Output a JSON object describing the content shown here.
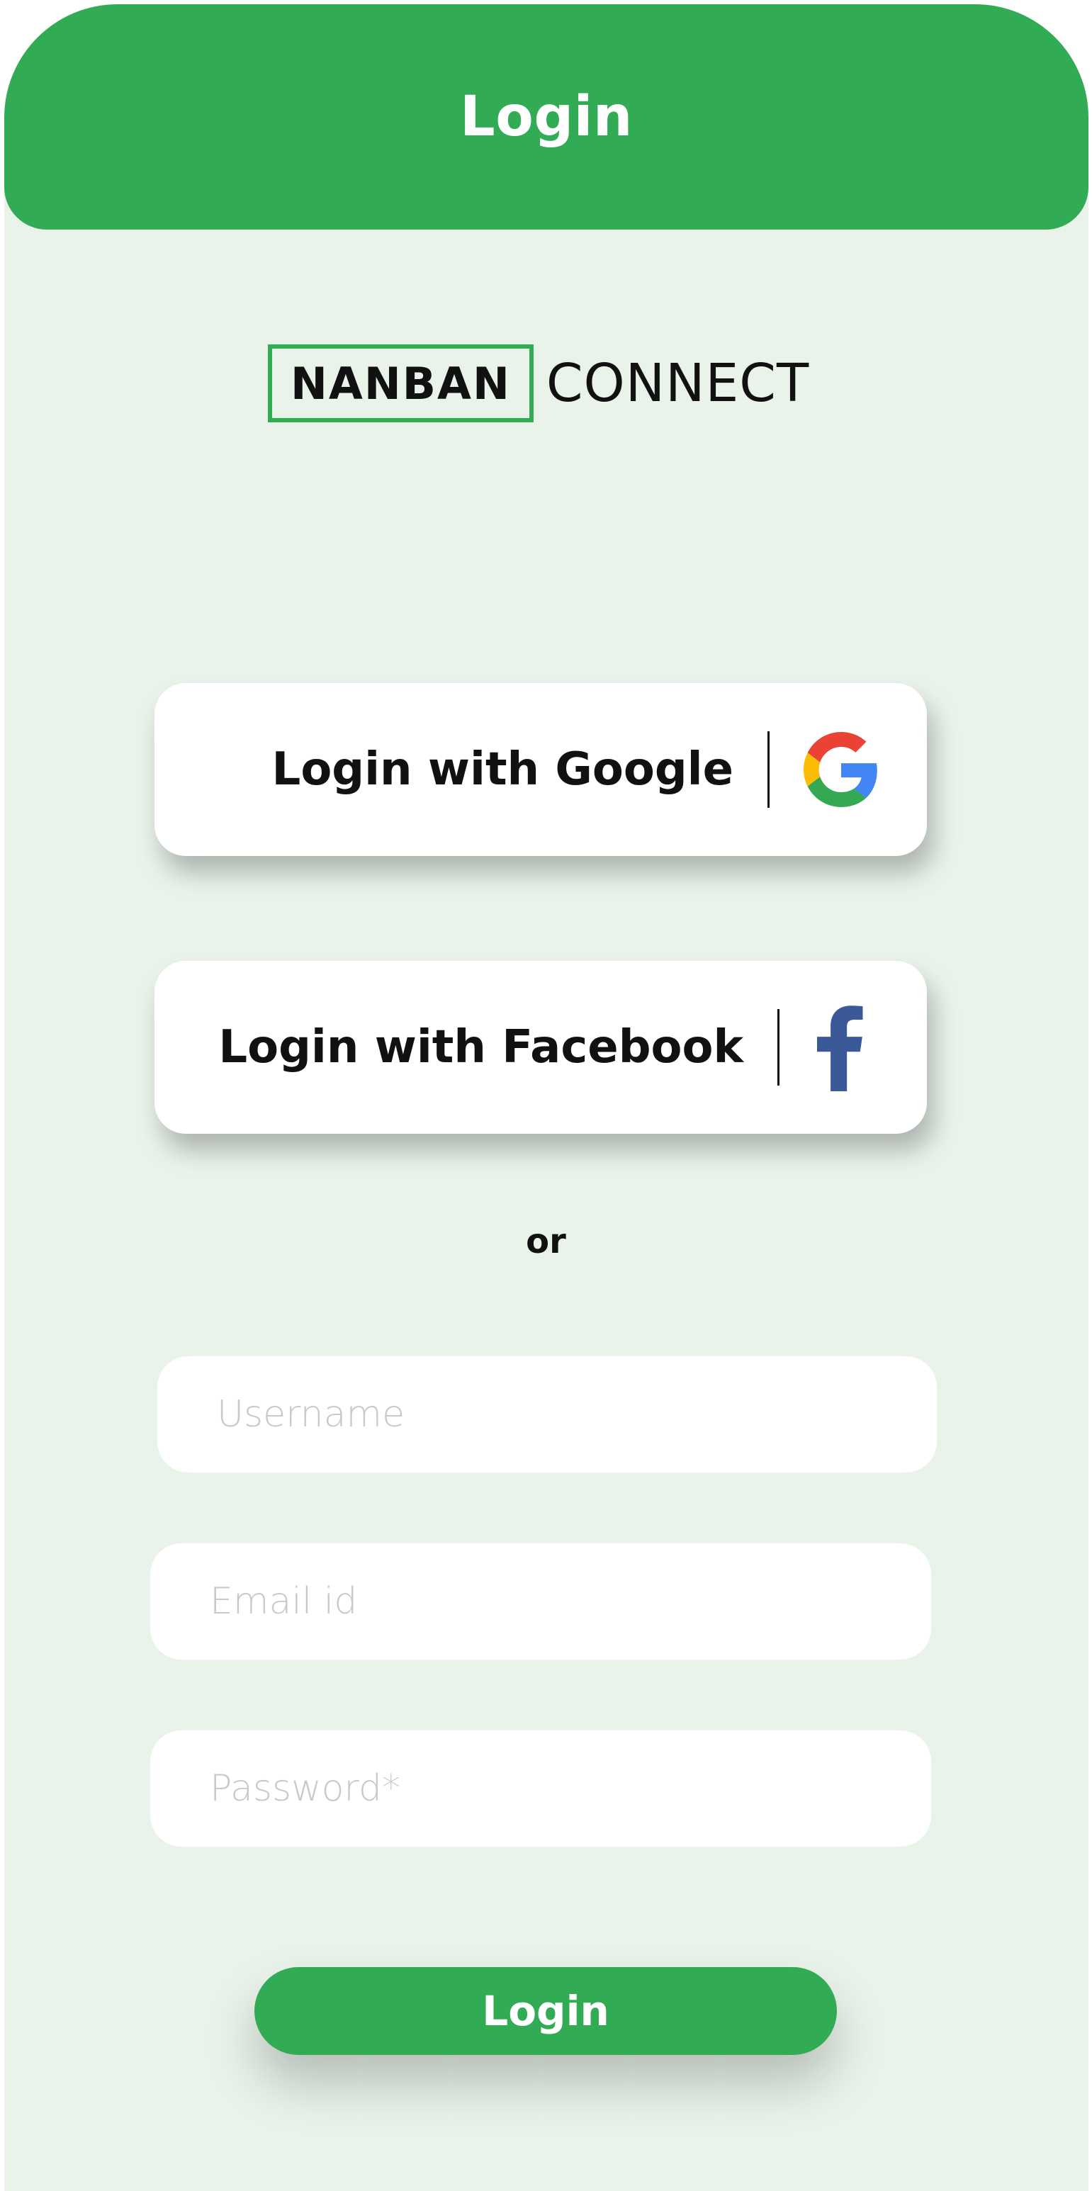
{
  "header": {
    "title": "Login"
  },
  "logo": {
    "boxed_text": "NANBAN",
    "text": "CONNECT"
  },
  "social": {
    "google": {
      "label": "Login with Google",
      "icon": "google-g-icon"
    },
    "facebook": {
      "label": "Login with Facebook",
      "icon": "facebook-f-icon"
    }
  },
  "separator": "or",
  "form": {
    "username_placeholder": "Username",
    "email_placeholder": "Email id",
    "password_placeholder": "Password*",
    "submit_label": "Login"
  },
  "colors": {
    "brand_green": "#32ab55",
    "background": "#e9f3ea",
    "facebook_blue": "#3b5998"
  }
}
